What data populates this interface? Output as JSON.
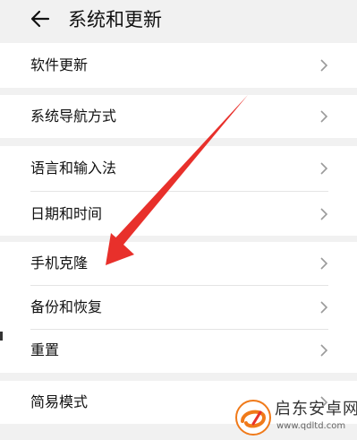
{
  "header": {
    "title": "系统和更新",
    "back_icon": "back-arrow-icon"
  },
  "groups": [
    {
      "items": [
        {
          "label": "软件更新"
        }
      ]
    },
    {
      "items": [
        {
          "label": "系统导航方式"
        }
      ]
    },
    {
      "items": [
        {
          "label": "语言和输入法"
        },
        {
          "label": "日期和时间"
        }
      ]
    },
    {
      "items": [
        {
          "label": "手机克隆"
        },
        {
          "label": "备份和恢复"
        },
        {
          "label": "重置"
        }
      ]
    },
    {
      "items": [
        {
          "label": "简易模式"
        }
      ]
    }
  ],
  "annotation": {
    "color": "#e8302b",
    "icon": "red-arrow-pointing-to-phone-clone"
  },
  "watermark": {
    "brand": "启东安卓网",
    "url": "www.qdltd.com",
    "logo_color": "#f07a1a"
  },
  "colors": {
    "background": "#f1f1f1",
    "card": "#ffffff",
    "divider": "#e4e4e4",
    "chevron": "#9a9a9a"
  }
}
